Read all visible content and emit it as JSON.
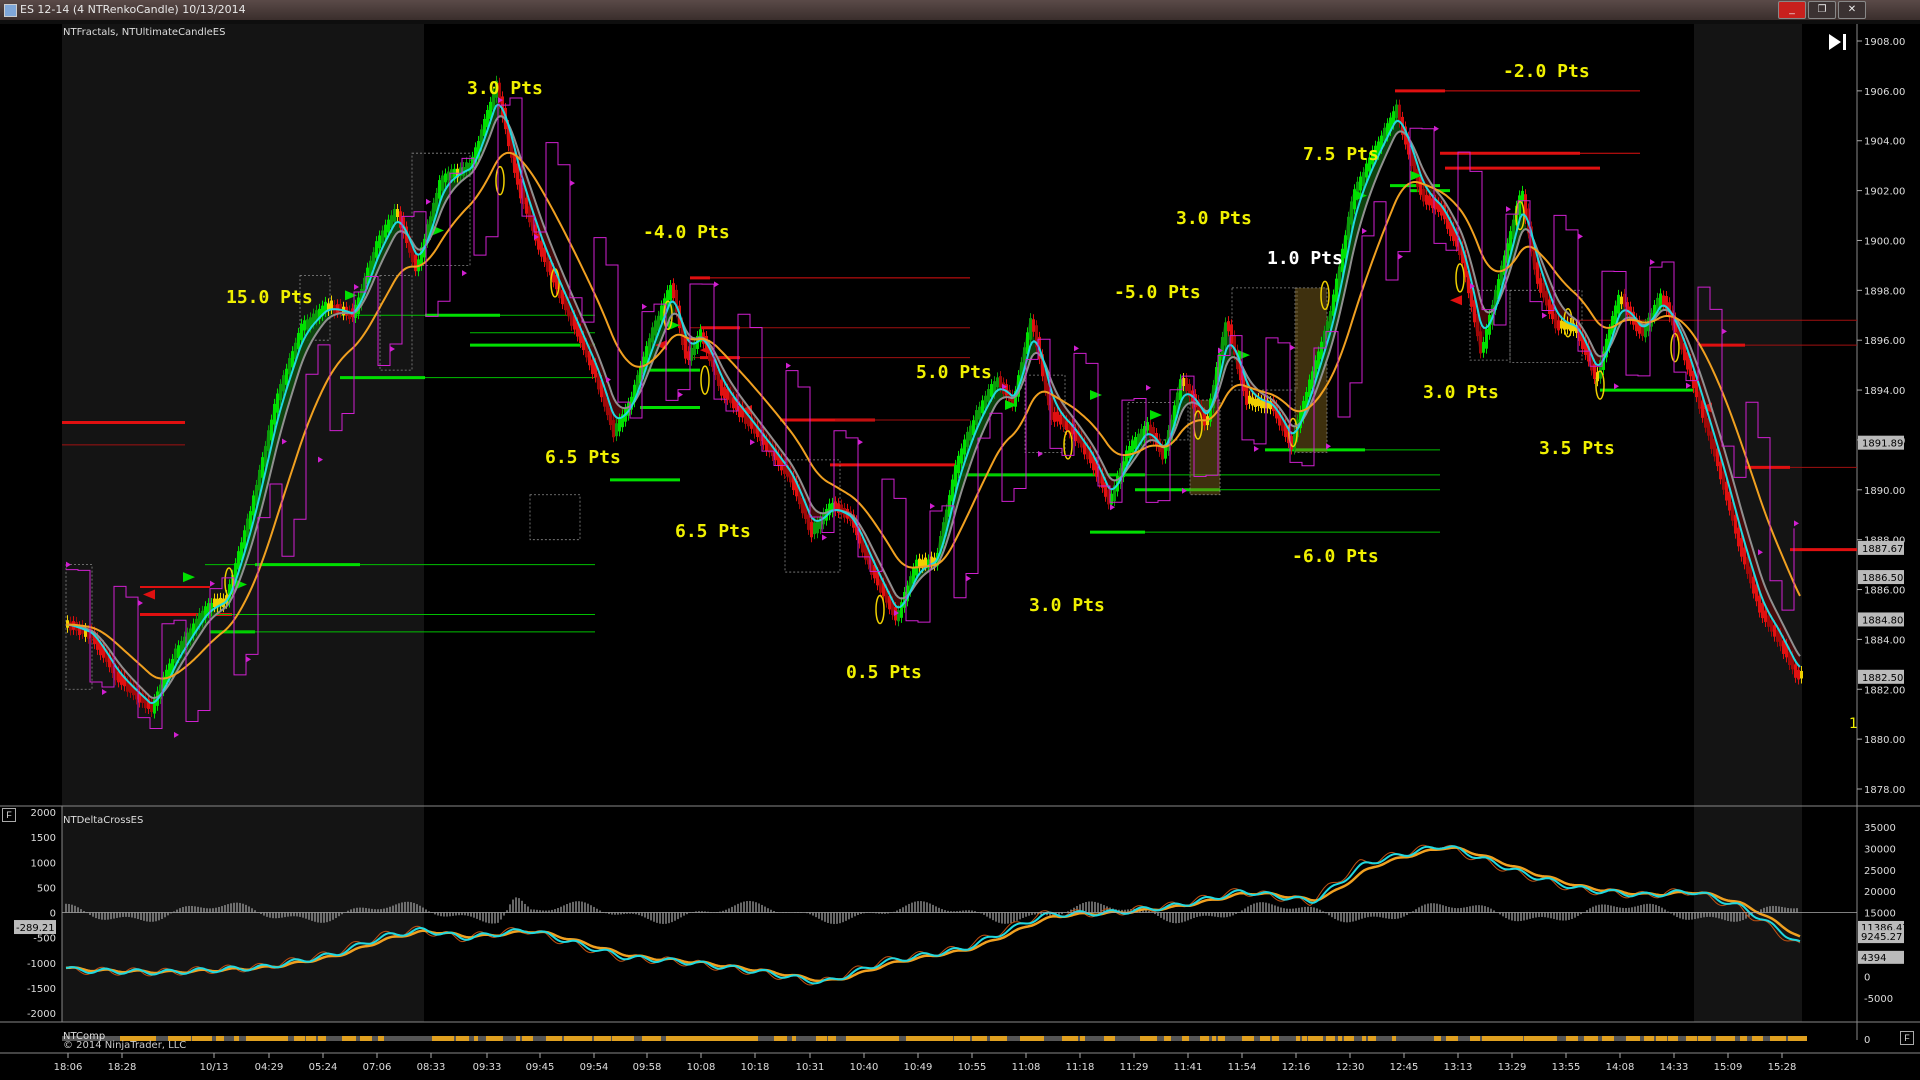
{
  "window": {
    "title": "ES 12-14 (4 NTRenkoCandle)  10/13/2014",
    "minimize_label": "_",
    "maximize_label": "❐",
    "close_label": "✕"
  },
  "panels": {
    "price_label": "NTFractals, NTUltimateCandleES",
    "delta_label": "NTDeltaCrossES",
    "bottom_label": "NTComp",
    "copyright": "© 2014 NinjaTrader, LLC",
    "f_button": "F"
  },
  "colors": {
    "up": "#00e000",
    "down": "#e01010",
    "neutral": "#f0d000",
    "ema_fast": "#20d8e0",
    "ema_slow": "#f0a020",
    "ma_mid": "#909090",
    "fractal": "#d020d0",
    "annotation": "#f0f000"
  },
  "annotations": [
    {
      "text": "3.0 Pts"
    },
    {
      "text": "-4.0 Pts"
    },
    {
      "text": "15.0 Pts"
    },
    {
      "text": "6.5 Pts"
    },
    {
      "text": "6.5 Pts"
    },
    {
      "text": "0.5 Pts"
    },
    {
      "text": "5.0 Pts"
    },
    {
      "text": "3.0 Pts"
    },
    {
      "text": "-5.0 Pts"
    },
    {
      "text": "3.0 Pts"
    },
    {
      "text": "1.0 Pts"
    },
    {
      "text": "7.5 Pts"
    },
    {
      "text": "-6.0 Pts"
    },
    {
      "text": "-2.0 Pts"
    },
    {
      "text": "3.0 Pts"
    },
    {
      "text": "3.5 Pts"
    }
  ],
  "price_axis": {
    "ticks": [
      "1908.00",
      "1906.00",
      "1904.00",
      "1902.00",
      "1900.00",
      "1898.00",
      "1896.00",
      "1894.00",
      "1892.00",
      "1890.00",
      "1888.00",
      "1886.00",
      "1884.00",
      "1882.00",
      "1880.00",
      "1878.00"
    ],
    "tags": [
      "1891.89",
      "1887.67",
      "1886.50",
      "1884.80",
      "1882.50"
    ]
  },
  "delta_axis_left": {
    "ticks": [
      "2000",
      "1500",
      "1000",
      "500",
      "0",
      "-500",
      "-1000",
      "-1500",
      "-2000"
    ],
    "tag": "-289.21"
  },
  "delta_axis_right": {
    "ticks": [
      "35000",
      "30000",
      "25000",
      "20000",
      "15000",
      "10000",
      "5000",
      "0",
      "-5000"
    ],
    "tags": [
      "11386.47",
      "9245.27",
      "4394"
    ]
  },
  "bottom_axis_right": {
    "tick": "0"
  },
  "time_axis": [
    "18:06",
    "18:28",
    "10/13",
    "04:29",
    "05:24",
    "07:06",
    "08:33",
    "09:33",
    "09:45",
    "09:54",
    "09:58",
    "10:08",
    "10:18",
    "10:31",
    "10:40",
    "10:49",
    "10:55",
    "11:08",
    "11:18",
    "11:29",
    "11:41",
    "11:54",
    "12:16",
    "12:30",
    "12:45",
    "13:13",
    "13:29",
    "13:55",
    "14:08",
    "14:33",
    "15:09",
    "15:28"
  ],
  "edge_text": "1"
}
